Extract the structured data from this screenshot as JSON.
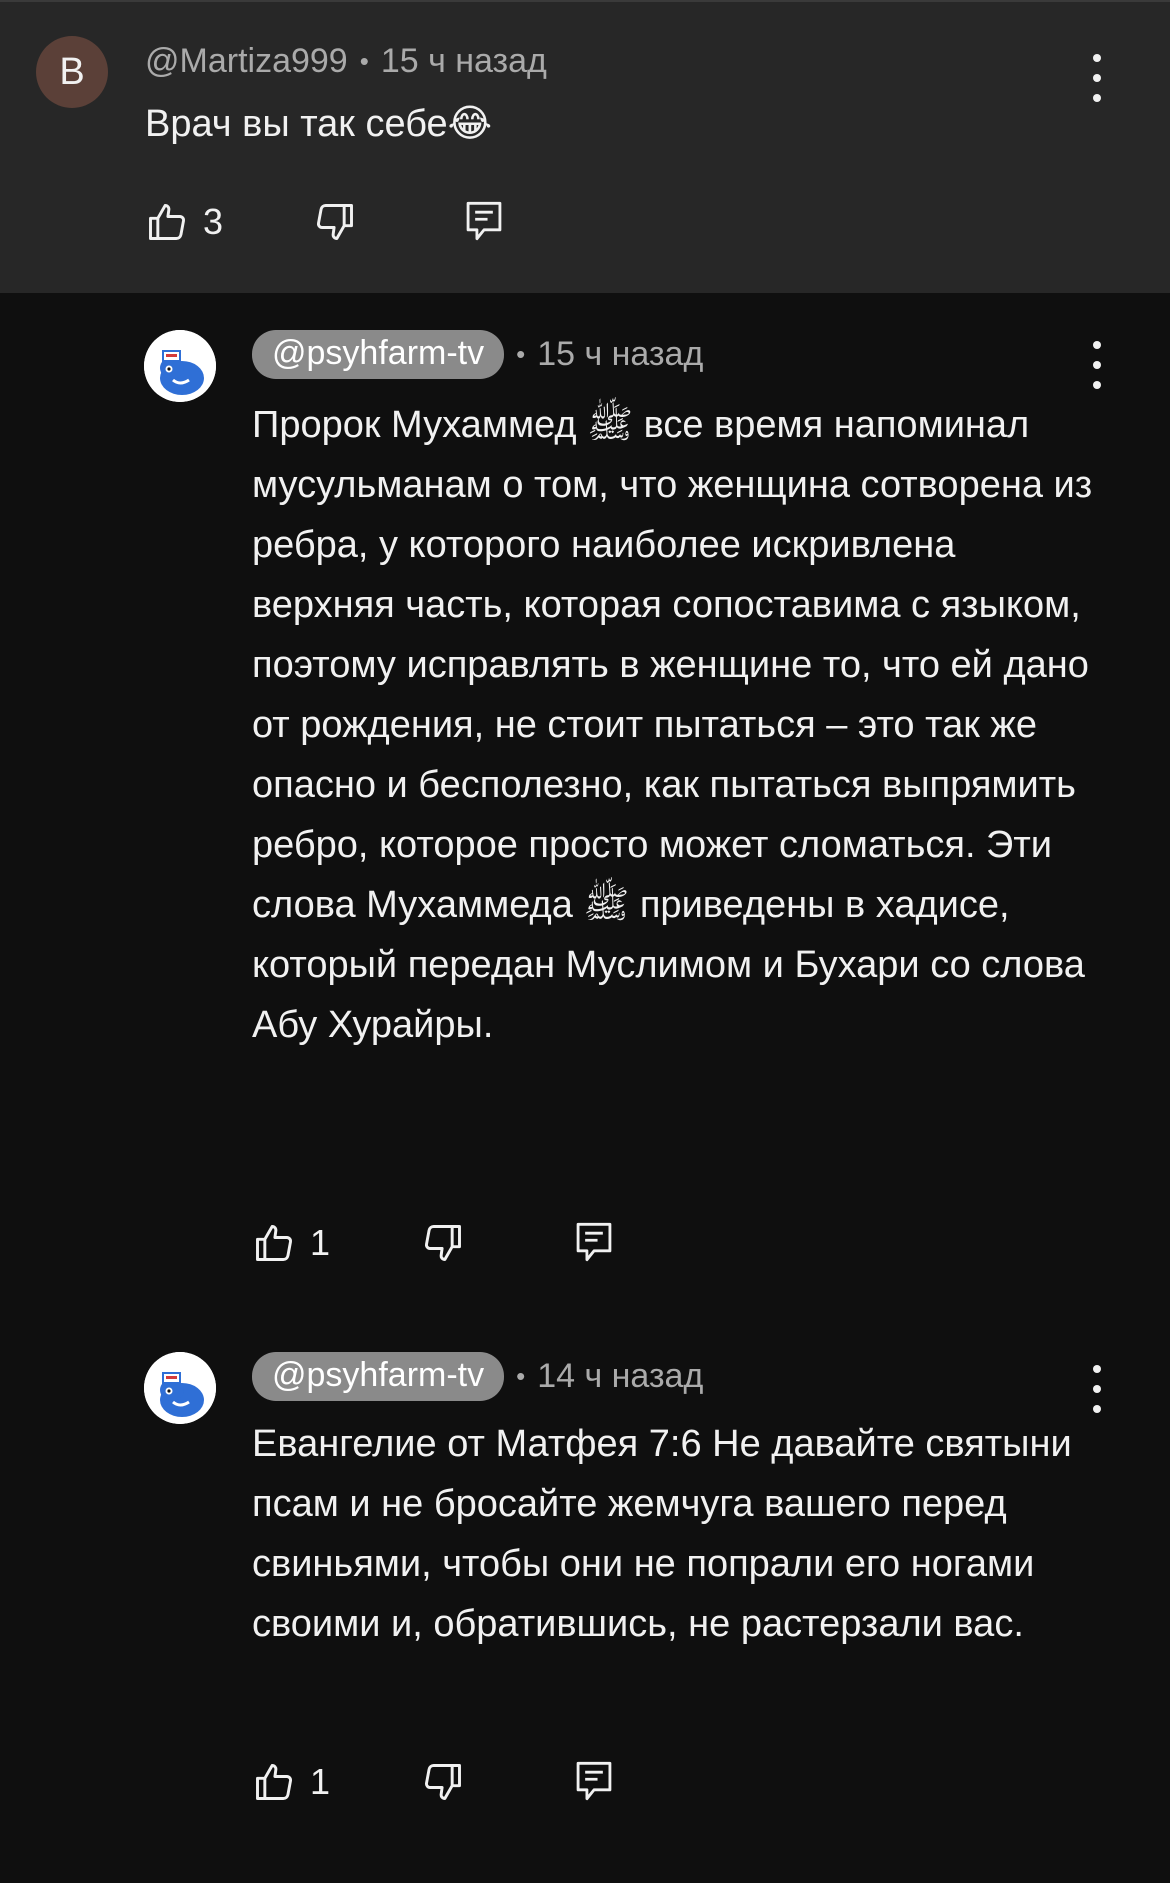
{
  "comments": [
    {
      "avatar_letter": "B",
      "handle": "@Martiza999",
      "separator": "•",
      "time": "15 ч назад",
      "text": "Врач вы так себе😂",
      "likes": "3",
      "icons": [
        "thumbs-up-icon",
        "thumbs-down-icon",
        "reply-icon",
        "more-vert-icon"
      ]
    },
    {
      "handle": "@psyhfarm-tv",
      "separator": "•",
      "time": "15 ч назад",
      "text": "Пророк Мухаммед ﷺ все время напоминал мусульманам о том, что женщина сотворена из ребра, у которого наиболее искривлена верхняя часть, которая сопоставима с языком, поэтому исправлять в женщине то, что ей дано от рождения, не стоит пытаться – это так же опасно и бесполезно, как пытаться выпрямить ребро, которое просто может сломаться. Эти слова Мухаммеда ﷺ приведены в хадисе, который передан Муслимом и Бухари со слова Абу Хурайры.",
      "likes": "1",
      "icons": [
        "thumbs-up-icon",
        "thumbs-down-icon",
        "reply-icon",
        "more-vert-icon"
      ]
    },
    {
      "handle": "@psyhfarm-tv",
      "separator": "•",
      "time": "14 ч назад",
      "text": "Евангелие от Матфея 7:6  Не давайте святыни псам и не бросайте жемчуга вашего перед свиньями, чтобы они не попрали его ногами своими и, обратившись, не растерзали вас.",
      "likes": "1",
      "icons": [
        "thumbs-up-icon",
        "thumbs-down-icon",
        "reply-icon",
        "more-vert-icon"
      ]
    }
  ],
  "colors": {
    "highlight_bg": "#272727",
    "page_bg": "#0f0f0f",
    "handle_pill": "#8a8a8a",
    "text": "#f1f1f1",
    "meta": "#aaaaaa"
  }
}
